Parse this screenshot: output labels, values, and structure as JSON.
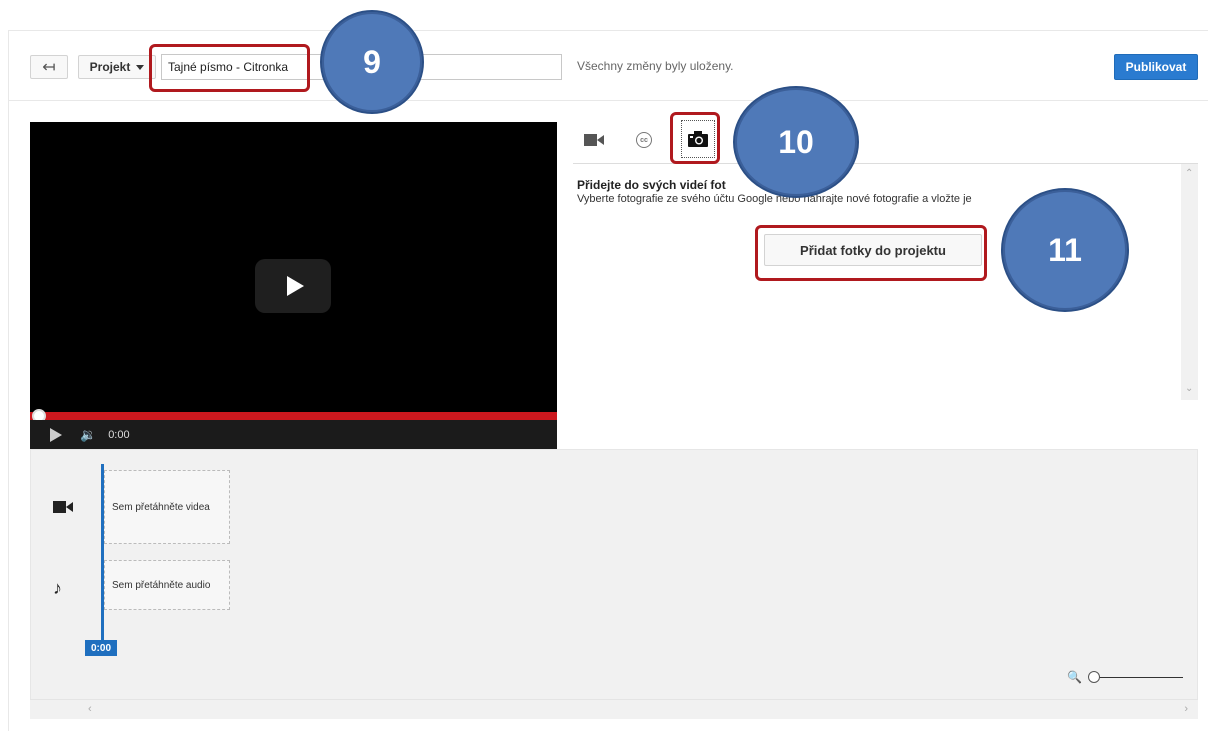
{
  "header": {
    "back_icon": "back-arrow-icon",
    "project_label": "Projekt",
    "title_value": "Tajné písmo - Citronka",
    "saved_status": "Všechny změny byly uloženy.",
    "publish_label": "Publikovat"
  },
  "player": {
    "time": "0:00",
    "progress_fraction": 0
  },
  "tabs": {
    "video_icon": "video-camera-icon",
    "cc_icon": "closed-captions-icon",
    "cc_text": "cc",
    "photo_icon": "camera-icon",
    "active": "photo"
  },
  "photo_panel": {
    "title": "Přidejte do svých videí fot",
    "description": "Vyberte fotografie ze svého účtu Google nebo nahrajte nové fotografie a vložte je",
    "add_button": "Přidat fotky do projektu"
  },
  "timeline": {
    "video_drop": "Sem přetáhněte videa",
    "audio_drop": "Sem přetáhněte audio",
    "playhead_time": "0:00"
  },
  "annotations": {
    "badge_9": "9",
    "badge_10": "10",
    "badge_11": "11",
    "highlight_color": "#b0191e",
    "badge_color": "#4f79b8"
  }
}
